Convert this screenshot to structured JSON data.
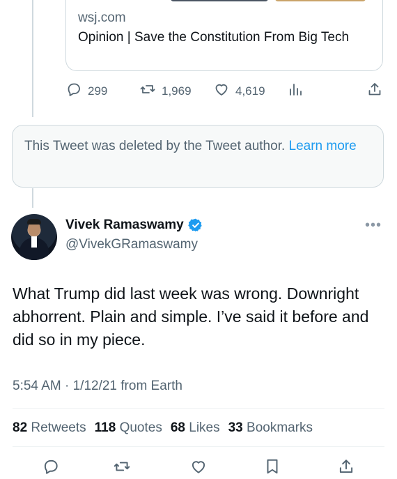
{
  "link_card": {
    "domain": "wsj.com",
    "title": "Opinion | Save the Constitution From Big Tech"
  },
  "previous_tweet_actions": {
    "replies": "299",
    "retweets": "1,969",
    "likes": "4,619"
  },
  "deleted_notice": {
    "text": "This Tweet was deleted by the Tweet author.",
    "link": "Learn more"
  },
  "tweet": {
    "author_name": "Vivek Ramaswamy",
    "handle": "@VivekGRamaswamy",
    "text": "What Trump did last week was wrong. Downright abhorrent. Plain and simple. I’ve said it before and did so in my piece.",
    "timestamp": "5:54 AM · 1/12/21 from Earth"
  },
  "stats": {
    "retweets_count": "82",
    "retweets_label": "Retweets",
    "quotes_count": "118",
    "quotes_label": "Quotes",
    "likes_count": "68",
    "likes_label": "Likes",
    "bookmarks_count": "33",
    "bookmarks_label": "Bookmarks"
  },
  "colors": {
    "link_blue": "#1d9bf0",
    "secondary_text": "#536471",
    "border": "#cfd9de"
  }
}
